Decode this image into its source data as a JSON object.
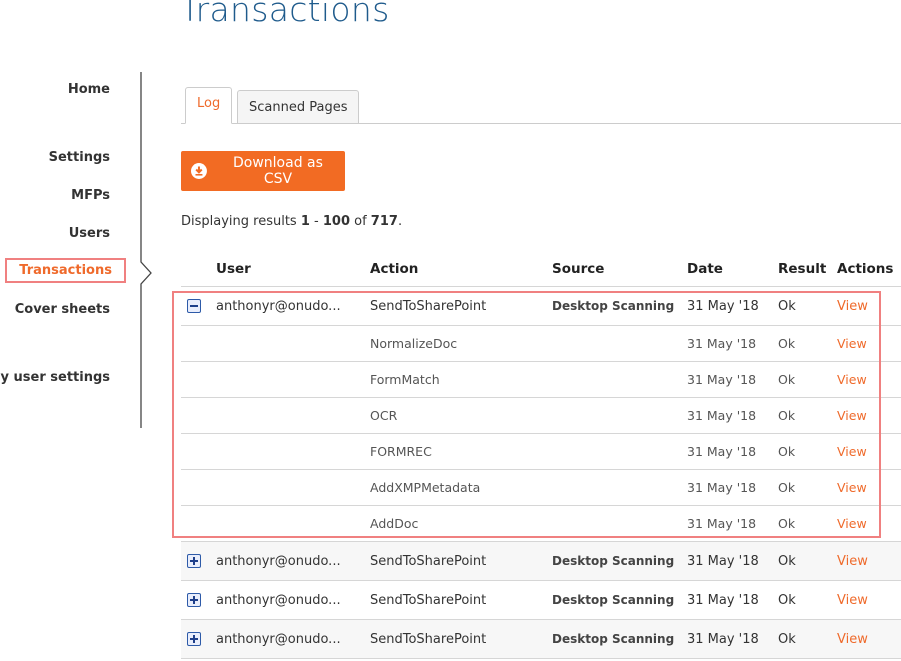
{
  "page": {
    "title": "Transactions"
  },
  "sidebar": {
    "items": [
      {
        "label": "Home",
        "active": false
      },
      {
        "label": "Settings",
        "active": false
      },
      {
        "label": "MFPs",
        "active": false
      },
      {
        "label": "Users",
        "active": false
      },
      {
        "label": "Transactions",
        "active": true
      },
      {
        "label": "Cover sheets",
        "active": false
      },
      {
        "label": "My user settings",
        "active": false
      }
    ]
  },
  "tabs": [
    {
      "label": "Log",
      "active": true
    },
    {
      "label": "Scanned Pages",
      "active": false
    }
  ],
  "toolbar": {
    "download_label": "Download as CSV",
    "download_icon": "download-circle-icon"
  },
  "results": {
    "prefix": "Displaying results ",
    "from": "1",
    "sep": " - ",
    "to": "100",
    "of": " of ",
    "total": "717",
    "suffix": "."
  },
  "table": {
    "headers": {
      "user": "User",
      "action": "Action",
      "source": "Source",
      "date": "Date",
      "result": "Result",
      "actions": "Actions"
    },
    "expanded": {
      "user": "anthonyr@onudo...",
      "action": "SendToSharePoint",
      "source": "Desktop Scanning",
      "date": "31 May '18",
      "result": "Ok",
      "link": "View",
      "steps": [
        {
          "action": "NormalizeDoc",
          "date": "31 May '18",
          "result": "Ok",
          "link": "View"
        },
        {
          "action": "FormMatch",
          "date": "31 May '18",
          "result": "Ok",
          "link": "View"
        },
        {
          "action": "OCR",
          "date": "31 May '18",
          "result": "Ok",
          "link": "View"
        },
        {
          "action": "FORMREC",
          "date": "31 May '18",
          "result": "Ok",
          "link": "View"
        },
        {
          "action": "AddXMPMetadata",
          "date": "31 May '18",
          "result": "Ok",
          "link": "View"
        },
        {
          "action": "AddDoc",
          "date": "31 May '18",
          "result": "Ok",
          "link": "View"
        }
      ]
    },
    "collapsed": [
      {
        "user": "anthonyr@onudo...",
        "action": "SendToSharePoint",
        "source": "Desktop Scanning",
        "date": "31 May '18",
        "result": "Ok",
        "link": "View"
      },
      {
        "user": "anthonyr@onudo...",
        "action": "SendToSharePoint",
        "source": "Desktop Scanning",
        "date": "31 May '18",
        "result": "Ok",
        "link": "View"
      },
      {
        "user": "anthonyr@onudo...",
        "action": "SendToSharePoint",
        "source": "Desktop Scanning",
        "date": "31 May '18",
        "result": "Ok",
        "link": "View"
      }
    ]
  },
  "colors": {
    "accent": "#f26b23",
    "title": "#1f5b8c",
    "highlight": "#f08080",
    "toggle": "#2d5aa8"
  }
}
